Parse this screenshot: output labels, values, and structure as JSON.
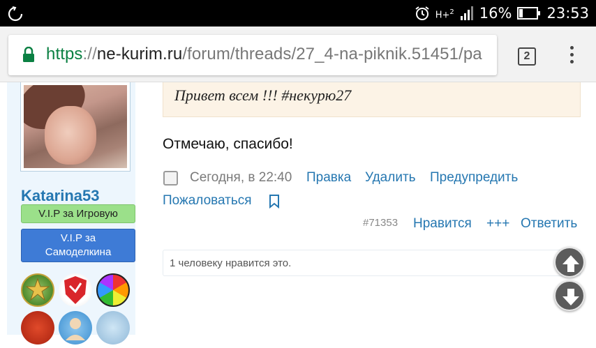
{
  "status_bar": {
    "network": "H+",
    "signal_sub": "2",
    "battery": "16%",
    "time": "23:53"
  },
  "address_bar": {
    "scheme": "https",
    "separator": "://",
    "host": "ne-kurim.ru",
    "path": "/forum/threads/27_4-na-piknik.51451/pa",
    "tab_count": "2"
  },
  "user": {
    "name": "Katarina53",
    "badge_green": "V.I.P за Игровую",
    "badge_blue": "V.I.P за Самоделкина"
  },
  "post": {
    "quote": "Привет всем !!! #некурю27",
    "message": "Отмечаю, спасибо!",
    "date": "Сегодня, в 22:40",
    "actions": {
      "edit": "Правка",
      "delete": "Удалить",
      "warn": "Предупредить",
      "report": "Пожаловаться"
    },
    "number": "#71353",
    "like": "Нравится",
    "plus": "+++",
    "reply": "Ответить",
    "likes_summary": "1 человеку нравится это."
  },
  "colors": {
    "link": "#2577b1",
    "https": "#0b8043",
    "quote_bg": "#fcf3e6",
    "badge_green": "#9be08a",
    "badge_blue": "#3e7bd6"
  }
}
